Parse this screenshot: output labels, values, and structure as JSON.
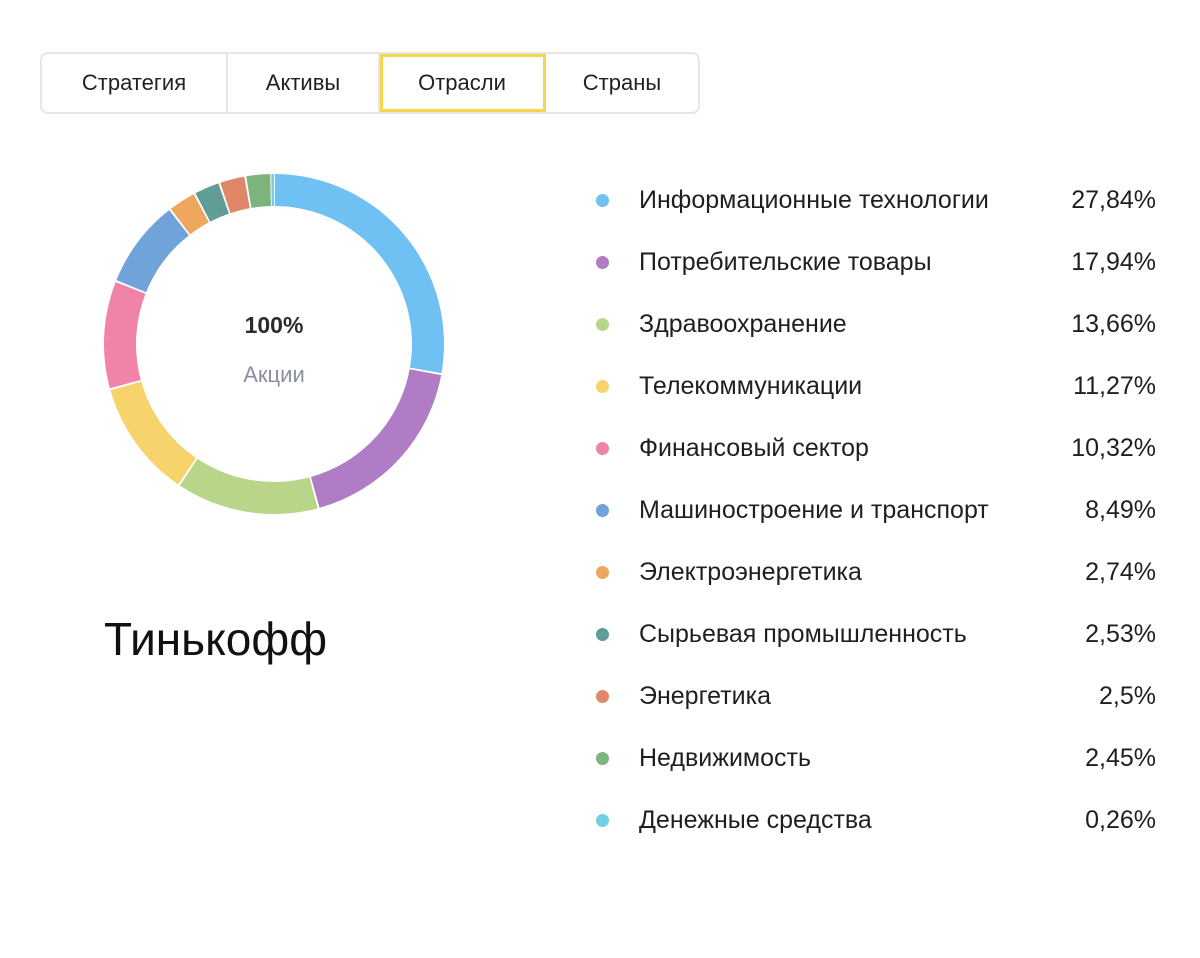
{
  "tabs": [
    {
      "label": "Стратегия",
      "active": false
    },
    {
      "label": "Активы",
      "active": false
    },
    {
      "label": "Отрасли",
      "active": true
    },
    {
      "label": "Страны",
      "active": false
    }
  ],
  "donut": {
    "center_value": "100%",
    "center_label": "Акции"
  },
  "fund_name": "Тинькофф",
  "chart_data": {
    "type": "pie",
    "variant": "donut",
    "categories": [
      "Информационные технологии",
      "Потребительские товары",
      "Здравоохранение",
      "Телекоммуникации",
      "Финансовый сектор",
      "Машиностроение и транспорт",
      "Электроэнергетика",
      "Сырьевая промышленность",
      "Энергетика",
      "Недвижимость",
      "Денежные средства"
    ],
    "values": [
      27.84,
      17.94,
      13.66,
      11.27,
      10.32,
      8.49,
      2.74,
      2.53,
      2.5,
      2.45,
      0.26
    ],
    "value_labels": [
      "27,84%",
      "17,94%",
      "13,66%",
      "11,27%",
      "10,32%",
      "8,49%",
      "2,74%",
      "2,53%",
      "2,5%",
      "2,45%",
      "0,26%"
    ],
    "colors": [
      "#6ec1f2",
      "#b07cc6",
      "#b9d58a",
      "#f7d46b",
      "#ef84a8",
      "#6fa3da",
      "#efa65e",
      "#5f9d96",
      "#e0876a",
      "#7db47c",
      "#6fd0e6"
    ],
    "legend_position": "right"
  }
}
